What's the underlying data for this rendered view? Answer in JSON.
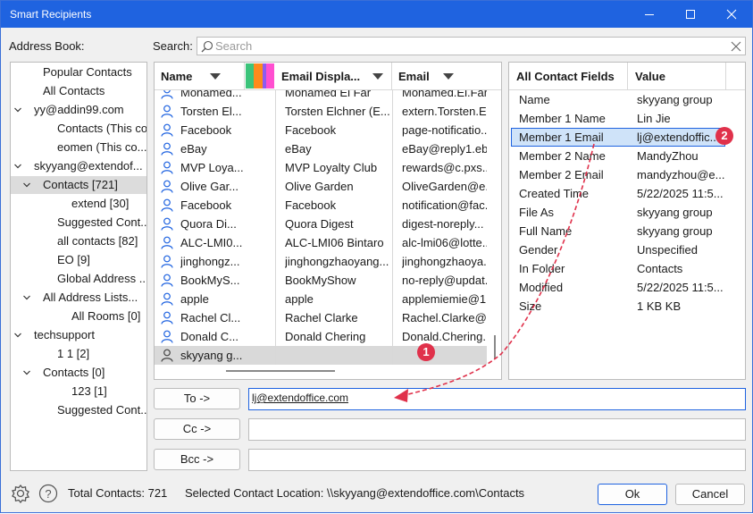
{
  "window": {
    "title": "Smart Recipients"
  },
  "labels": {
    "address_book": "Address Book:",
    "search": "Search:"
  },
  "search": {
    "placeholder": "Search"
  },
  "tree": [
    {
      "label": "Popular Contacts",
      "level": 1,
      "toggle": ""
    },
    {
      "label": "All Contacts",
      "level": 1,
      "toggle": ""
    },
    {
      "label": "yy@addin99.com",
      "level": 0,
      "toggle": "expanded"
    },
    {
      "label": "Contacts (This co...",
      "level": 2,
      "toggle": ""
    },
    {
      "label": "eomen (This co...",
      "level": 2,
      "toggle": ""
    },
    {
      "label": "skyyang@extendof...",
      "level": 0,
      "toggle": "expanded"
    },
    {
      "label": "Contacts [721]",
      "level": 1,
      "toggle": "expanded",
      "selected": true
    },
    {
      "label": "extend [30]",
      "level": 3,
      "toggle": ""
    },
    {
      "label": "Suggested Cont...",
      "level": 2,
      "toggle": ""
    },
    {
      "label": "all contacts [82]",
      "level": 2,
      "toggle": ""
    },
    {
      "label": "EO [9]",
      "level": 2,
      "toggle": ""
    },
    {
      "label": "Global Address ...",
      "level": 2,
      "toggle": ""
    },
    {
      "label": "All Address Lists...",
      "level": 1,
      "toggle": "expanded"
    },
    {
      "label": "All Rooms [0]",
      "level": 3,
      "toggle": ""
    },
    {
      "label": "techsupport",
      "level": 0,
      "toggle": "expanded"
    },
    {
      "label": "1 1 [2]",
      "level": 2,
      "toggle": ""
    },
    {
      "label": "Contacts [0]",
      "level": 1,
      "toggle": "expanded"
    },
    {
      "label": "123 [1]",
      "level": 3,
      "toggle": ""
    },
    {
      "label": "Suggested Cont...",
      "level": 2,
      "toggle": ""
    }
  ],
  "grid": {
    "columns": [
      "Name",
      "Email Displa...",
      "Email"
    ],
    "rows": [
      {
        "name": "Monamed...",
        "display": "Monamed El Far",
        "email": "Mohamed.El.Far..."
      },
      {
        "name": "Torsten El...",
        "display": "Torsten Elchner (E...",
        "email": "extern.Torsten.El..."
      },
      {
        "name": "Facebook",
        "display": "Facebook",
        "email": "page-notificatio..."
      },
      {
        "name": "eBay",
        "display": "eBay",
        "email": "eBay@reply1.eb..."
      },
      {
        "name": "MVP Loya...",
        "display": "MVP Loyalty Club",
        "email": "rewards@c.pxs..."
      },
      {
        "name": "Olive Gar...",
        "display": "Olive Garden",
        "email": "OliveGarden@e..."
      },
      {
        "name": "Facebook",
        "display": "Facebook",
        "email": "notification@fac..."
      },
      {
        "name": "Quora Di...",
        "display": "Quora Digest",
        "email": "digest-noreply..."
      },
      {
        "name": "ALC-LMI0...",
        "display": "ALC-LMI06 Bintaro",
        "email": "alc-lmi06@lotte..."
      },
      {
        "name": "jinghongz...",
        "display": "jinghongzhaoyang...",
        "email": "jinghongzhaoya..."
      },
      {
        "name": "BookMyS...",
        "display": "BookMyShow",
        "email": "no-reply@updat..."
      },
      {
        "name": "apple",
        "display": "apple",
        "email": "applemiemie@1..."
      },
      {
        "name": "Rachel Cl...",
        "display": "Rachel Clarke",
        "email": "Rachel.Clarke@s..."
      },
      {
        "name": "Donald C...",
        "display": "Donald Chering",
        "email": "Donald.Chering..."
      },
      {
        "name": "skyyang g...",
        "display": "",
        "email": "",
        "selected": true
      }
    ]
  },
  "fields": {
    "columns": [
      "All Contact Fields",
      "Value"
    ],
    "rows": [
      {
        "field": "Name",
        "value": "skyyang group"
      },
      {
        "field": "Member 1 Name",
        "value": "Lin Jie"
      },
      {
        "field": "Member 1 Email",
        "value": "lj@extendoffic...",
        "selected": true
      },
      {
        "field": "Member 2 Name",
        "value": "MandyZhou"
      },
      {
        "field": "Member 2 Email",
        "value": "mandyzhou@e..."
      },
      {
        "field": "Created Time",
        "value": "5/22/2025 11:5..."
      },
      {
        "field": "File As",
        "value": "skyyang group"
      },
      {
        "field": "Full Name",
        "value": "skyyang group"
      },
      {
        "field": "Gender",
        "value": "Unspecified"
      },
      {
        "field": "In Folder",
        "value": "Contacts"
      },
      {
        "field": "Modified",
        "value": "5/22/2025 11:5..."
      },
      {
        "field": "Size",
        "value": "1 KB KB"
      }
    ]
  },
  "recipients": {
    "to_label": "To ->",
    "cc_label": "Cc ->",
    "bcc_label": "Bcc ->",
    "to_value": "lj@extendoffice.com",
    "cc_value": "",
    "bcc_value": ""
  },
  "badges": {
    "one": "1",
    "two": "2"
  },
  "status": {
    "total": "Total Contacts: 721",
    "location": "Selected Contact Location: \\\\skyyang@extendoffice.com\\Contacts"
  },
  "buttons": {
    "ok": "Ok",
    "cancel": "Cancel"
  },
  "colors": {
    "accent": "#1f63e0",
    "badge": "#e0314b",
    "arrow": "#e0314b"
  },
  "icons": {
    "color_strip": [
      "#3cc47b",
      "#ff8a1c",
      "#8e5cf0",
      "#ff4fd0"
    ]
  }
}
